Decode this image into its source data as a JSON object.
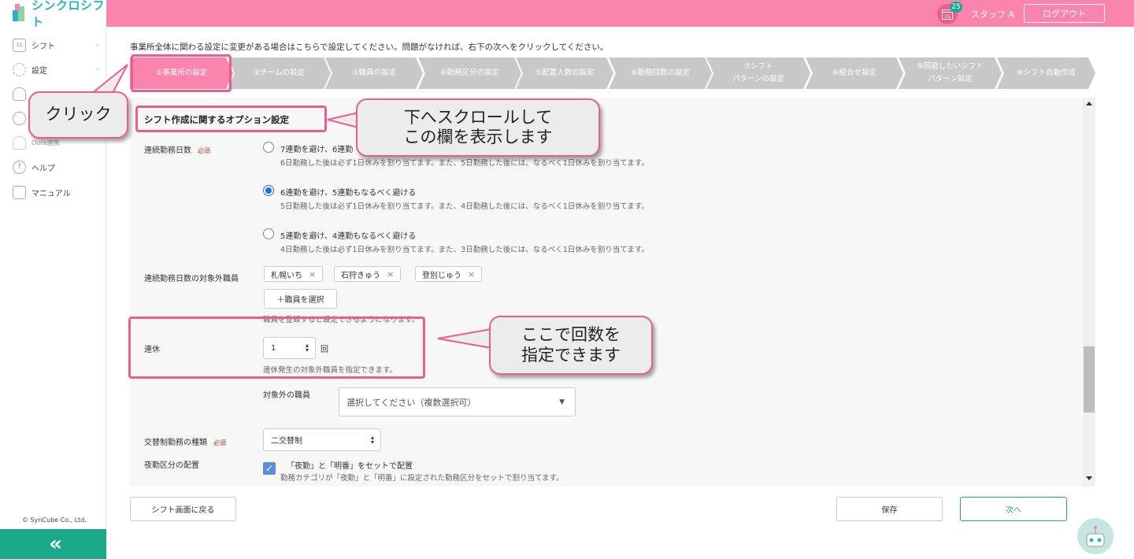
{
  "app": {
    "logo_text": "シンクロシフト",
    "calendar_day": "15",
    "notification_count": "25",
    "staff_name": "スタッフ A",
    "logout_label": "ログアウト"
  },
  "sidebar": {
    "items": [
      {
        "label": "シフト",
        "icon": "calendar-icon"
      },
      {
        "label": "設定",
        "icon": "gear-icon"
      },
      {
        "label": "",
        "icon": "database-icon"
      },
      {
        "label": "",
        "icon": "cloud-icon"
      },
      {
        "label": "Oura連携",
        "icon": "database-icon"
      },
      {
        "label": "ヘルプ",
        "icon": "help-icon"
      },
      {
        "label": "マニュアル",
        "icon": "manual-icon"
      }
    ],
    "copyright": "© SynCube Co., Ltd.",
    "collapse_glyph": "«"
  },
  "notice": "事業所全体に関わる設定に変更がある場合はこちらで設定してください。問題がなければ、右下の次へをクリックしてください。",
  "steps": [
    "①事業所の設定",
    "②チームの設定",
    "③職員の設定",
    "④勤務区分の設定",
    "⑤配置人数の設定",
    "⑥勤務回数の設定",
    "⑦シフト\nパターンの設定",
    "⑧組合せ設定",
    "⑨回避したいシフト\nパターン設定",
    "⑩シフト自動作成"
  ],
  "section_title": "シフト作成に関するオプション設定",
  "consecutive": {
    "label": "連続勤務日数",
    "required": "必須",
    "options": [
      {
        "title": "7連勤を避け、6連勤",
        "desc": "6日勤務した後は必ず1日休みを割り当てます。また、5日勤務した後には、なるべく1日休みを割り当てます。",
        "selected": false
      },
      {
        "title": "6連勤を避け、5連勤もなるべく避ける",
        "desc": "5日勤務した後は必ず1日休みを割り当てます。また、4日勤務した後には、なるべく1日休みを割り当てます。",
        "selected": true
      },
      {
        "title": "5連勤を避け、4連勤もなるべく避ける",
        "desc": "4日勤務した後は必ず1日休みを割り当てます。また、3日勤務した後には、なるべく1日休みを割り当てます。",
        "selected": false
      }
    ]
  },
  "excluded": {
    "label": "連続勤務日数の対象外職員",
    "chips": [
      "札幌いち",
      "石狩きゅう",
      "登別じゅう"
    ],
    "add_button": "＋職員を選択",
    "hint": "職員を登録すると設定できるようになります。"
  },
  "renkyu": {
    "label": "連休",
    "value": "1",
    "unit": "回",
    "hint": "連休発生の対象外職員を指定できます。",
    "target_label": "対象外の職員",
    "target_placeholder": "選択してください（複数選択可）"
  },
  "rotation": {
    "label": "交替制勤務の種類",
    "required": "必須",
    "value": "二交替制"
  },
  "night": {
    "label": "夜勤区分の配置",
    "check_title": "「夜勤」と「明番」をセットで配置",
    "check_desc": "勤務カテゴリが「夜勤」と「明番」に設定された勤務区分をセットで割り当てます。",
    "checked": true
  },
  "footer": {
    "back_label": "シフト画面に戻る",
    "save_label": "保存",
    "next_label": "次へ"
  },
  "callouts": {
    "click": "クリック",
    "scroll_line1": "下へスクロールして",
    "scroll_line2": "この欄を表示します",
    "count_line1": "ここで回数を",
    "count_line2": "指定できます"
  },
  "colors": {
    "brand_pink": "#fb84ad",
    "accent_green": "#1aa98a",
    "highlight": "#ea5f8d"
  }
}
